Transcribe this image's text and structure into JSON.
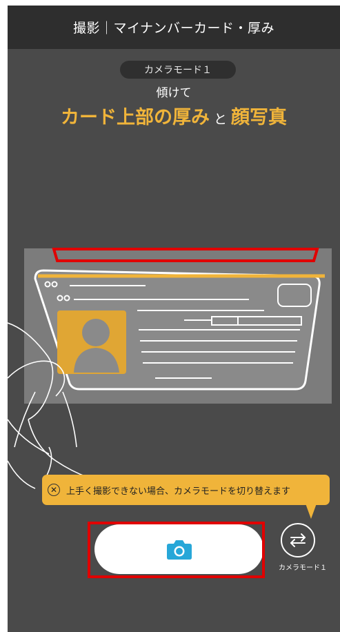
{
  "header": {
    "title": "撮影｜マイナンバーカード・厚み"
  },
  "camera": {
    "mode_pill": "カメラモード１",
    "tilt_text": "傾けて",
    "instruction": {
      "part1": "カード上部の厚み",
      "connector": "と",
      "part2": "顔写真"
    }
  },
  "hint": {
    "text": "上手く撮影できない場合、カメラモードを切り替えます"
  },
  "controls": {
    "mode_switch_label": "カメラモード１"
  },
  "colors": {
    "accent": "#f0b43a",
    "shutter_icon": "#27a7d8",
    "highlight": "#e00000",
    "bar": "#2e2e2e"
  },
  "icons": {
    "shutter": "camera-icon",
    "mode_switch": "swap-arrows-icon",
    "hint_close": "close-circle-icon"
  }
}
